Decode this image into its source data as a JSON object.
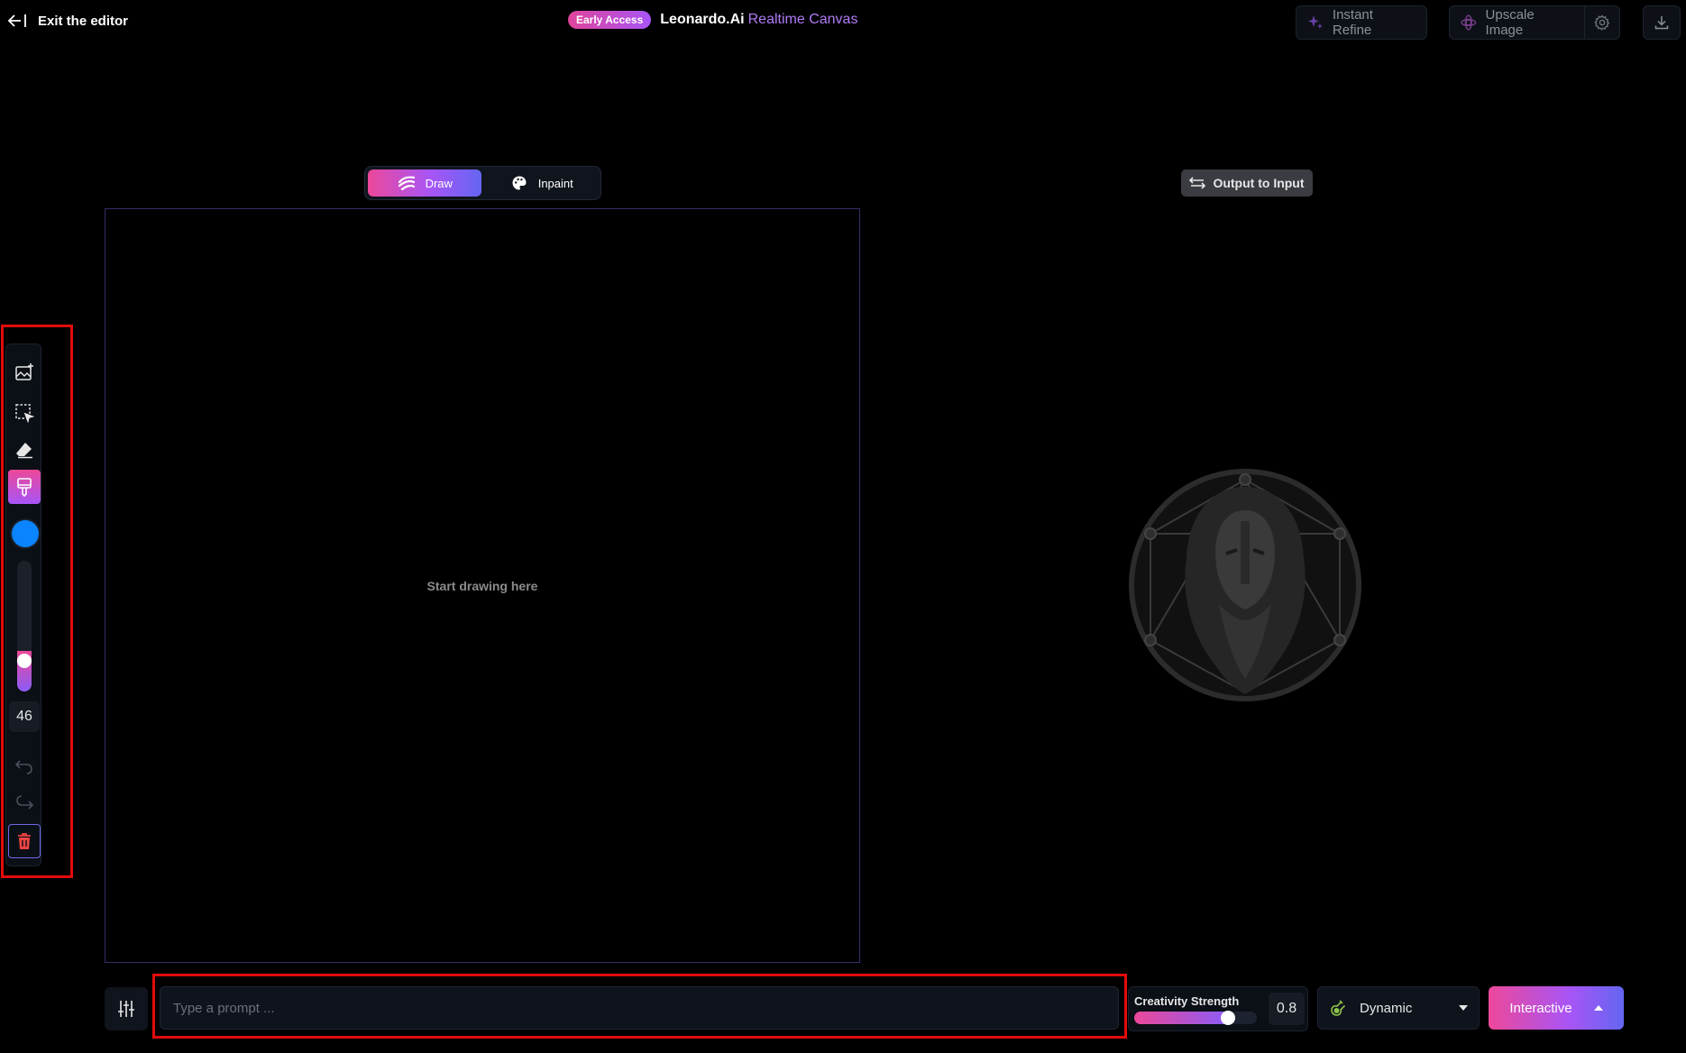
{
  "header": {
    "exit_label": "Exit the editor",
    "badge": "Early Access",
    "brand": "Leonardo.Ai",
    "brand_sub": "Realtime Canvas",
    "instant_refine": "Instant Refine",
    "upscale_image": "Upscale Image"
  },
  "modes": [
    {
      "label": "Draw",
      "active": true
    },
    {
      "label": "Inpaint",
      "active": false
    }
  ],
  "output_to_input": "Output to Input",
  "canvas": {
    "hint": "Start drawing here"
  },
  "toolbar": {
    "brush_color": "#0a84ff",
    "brush_size": "46",
    "brush_size_fraction": 0.2,
    "tools": [
      "add-image-icon",
      "select-icon",
      "eraser-icon",
      "brush-icon",
      "undo-icon",
      "redo-icon",
      "trash-icon"
    ]
  },
  "bottom": {
    "prompt_placeholder": "Type a prompt ...",
    "creativity_label": "Creativity Strength",
    "creativity_value": "0.8",
    "creativity_fraction": 0.8,
    "style": "Dynamic",
    "mode_button": "Interactive"
  },
  "colors": {
    "accent_pink": "#ec4899",
    "accent_purple": "#a855f7",
    "accent_indigo": "#6366f1",
    "highlight_red": "#e20b0b"
  }
}
